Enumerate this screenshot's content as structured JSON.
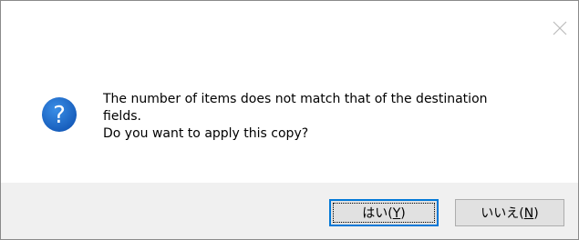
{
  "dialog": {
    "close_icon": "close-x-icon",
    "message_icon": "question-icon",
    "message_lines": [
      "The number of items does not match that of the destination",
      "fields.",
      "Do you want to apply this copy?"
    ],
    "buttons": {
      "yes": {
        "label_main": "はい(",
        "mnemonic": "Y",
        "label_end": ")"
      },
      "no": {
        "label_main": "いいえ(",
        "mnemonic": "N",
        "label_end": ")"
      }
    },
    "colors": {
      "icon_blue": "#1b6ac9",
      "focus_border": "#0078d7",
      "footer_bg": "#f0f0f0"
    }
  }
}
